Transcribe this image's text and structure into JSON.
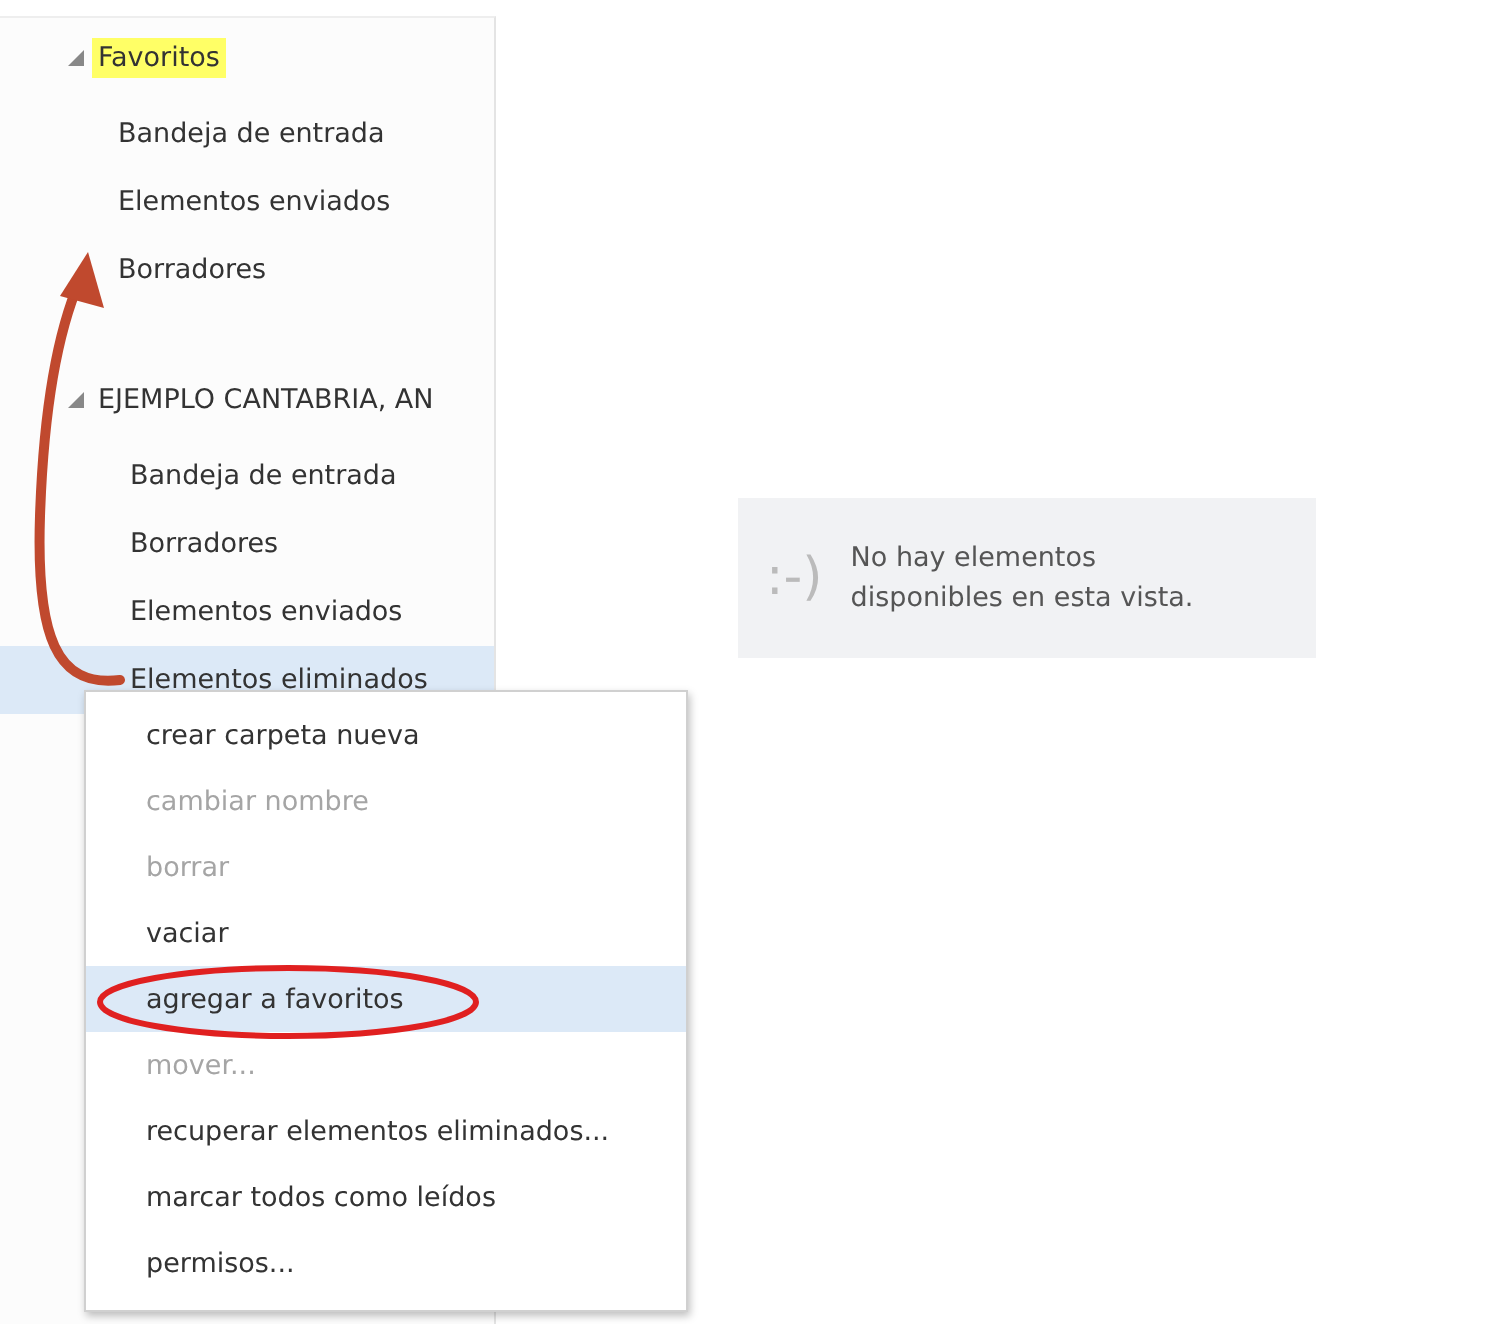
{
  "favorites": {
    "label": "Favoritos",
    "expanded": true,
    "highlighted": true,
    "items": [
      {
        "label": "Bandeja de entrada",
        "selected": false
      },
      {
        "label": "Elementos enviados",
        "selected": false
      },
      {
        "label": "Borradores",
        "selected": false
      }
    ]
  },
  "account": {
    "label": "EJEMPLO CANTABRIA, AN",
    "expanded": true,
    "highlighted": false,
    "items": [
      {
        "label": "Bandeja de entrada",
        "selected": false
      },
      {
        "label": "Borradores",
        "selected": false
      },
      {
        "label": "Elementos enviados",
        "selected": false
      },
      {
        "label": "Elementos eliminados",
        "selected": true
      }
    ]
  },
  "context_menu": [
    {
      "label": "crear carpeta nueva",
      "disabled": false,
      "selected": false
    },
    {
      "label": "cambiar nombre",
      "disabled": true,
      "selected": false
    },
    {
      "label": "borrar",
      "disabled": true,
      "selected": false
    },
    {
      "label": "vaciar",
      "disabled": false,
      "selected": false
    },
    {
      "label": "agregar a favoritos",
      "disabled": false,
      "selected": true
    },
    {
      "label": "mover...",
      "disabled": true,
      "selected": false
    },
    {
      "label": "recuperar elementos eliminados...",
      "disabled": false,
      "selected": false
    },
    {
      "label": "marcar todos como leídos",
      "disabled": false,
      "selected": false
    },
    {
      "label": "permisos...",
      "disabled": false,
      "selected": false
    }
  ],
  "empty_state": {
    "emoticon": ":-)",
    "message": "No hay elementos disponibles en esta vista."
  }
}
